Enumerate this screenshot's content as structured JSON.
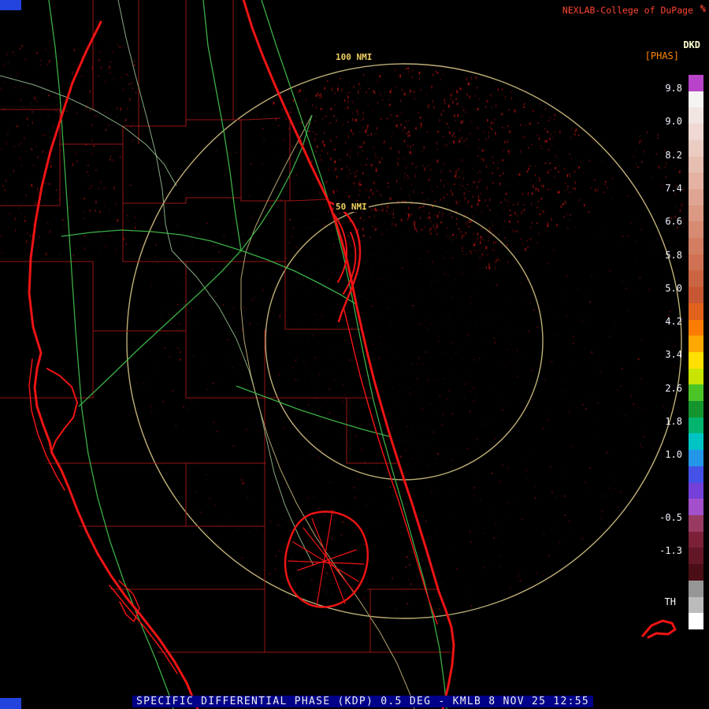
{
  "header": {
    "brand": "NEXLAB-College of DuPage",
    "brand_icon": "%",
    "product_code": "DKD",
    "product_units": "[PHAS]"
  },
  "colorbar": {
    "tick_labels": [
      "9.8",
      "9.0",
      "8.2",
      "7.4",
      "6.6",
      "5.8",
      "5.0",
      "4.2",
      "3.4",
      "2.6",
      "1.8",
      "1.0",
      "-0.5",
      "-1.3"
    ],
    "threshold_label": "TH",
    "segments": [
      "#b842c8",
      "#f6f4f2",
      "#f3e6e2",
      "#efd9d2",
      "#ebccc2",
      "#e7bfb2",
      "#e3b2a2",
      "#dfa592",
      "#db9882",
      "#d78b72",
      "#d37e62",
      "#cf7152",
      "#cb6442",
      "#c75732",
      "#e0621c",
      "#fb7c00",
      "#ffa800",
      "#ffe000",
      "#c8e400",
      "#4cc428",
      "#14942e",
      "#00b470",
      "#00c4c4",
      "#2496e8",
      "#4452e8",
      "#7440d8",
      "#a450cc",
      "#983a62",
      "#7c2038",
      "#621626",
      "#4a0e16",
      "#969696",
      "#bcbcbc",
      "#ffffff"
    ]
  },
  "map": {
    "ring_labels": [
      {
        "text": "100 NMI"
      },
      {
        "text": "50 NMI"
      }
    ]
  },
  "footer": {
    "status_text": "SPECIFIC DIFFERENTIAL PHASE (KDP) 0.5 DEG - KMLB 8 NOV 25 12:55"
  },
  "palette": {
    "brand_red": "#ff4433",
    "prod_code_color": "#ffffd0",
    "units_orange": "#ff8800",
    "tick_white": "#f2f2ff",
    "ring_tan": "#c9b87c",
    "ring_label_yellow": "#f0d060",
    "coast_red": "#ee1414",
    "county_red": "#a01616",
    "road_green": "#3db84a",
    "road_pale": "#a6d6a0",
    "road_tan": "#c9b87c",
    "noise_red": "#c41414",
    "footer_bg": "#000088",
    "footer_text": "#f0f0f0",
    "corner_blue": "#2244dd"
  }
}
